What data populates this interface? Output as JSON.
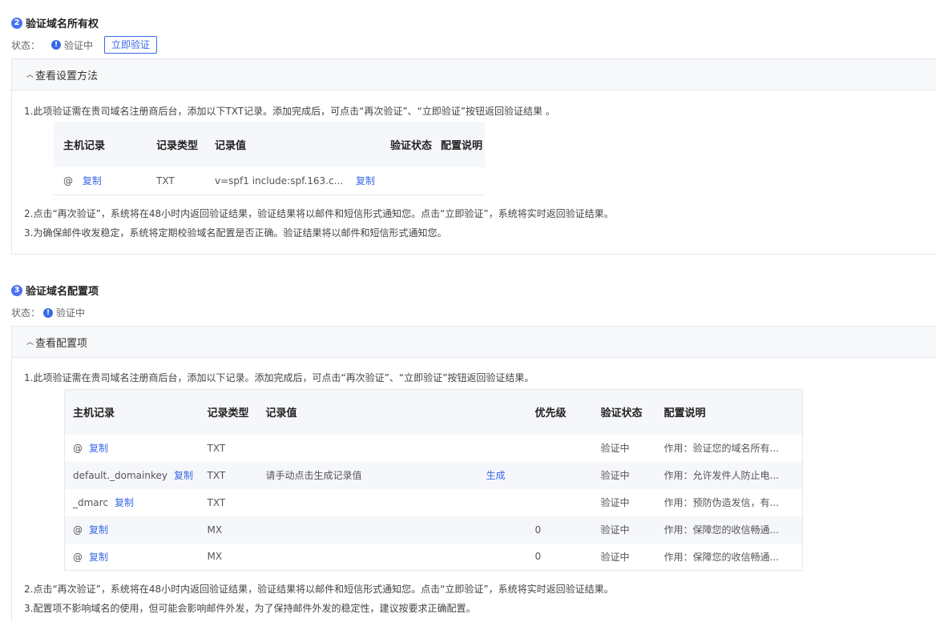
{
  "section2": {
    "step": "2",
    "title": "验证域名所有权",
    "status_label": "状态：",
    "status_value": "验证中",
    "verify_button": "立即验证",
    "panel_title": "查看设置方法",
    "line1": "1.此项验证需在贵司域名注册商后台，添加以下TXT记录。添加完成后，可点击“再次验证”、“立即验证”按钮返回验证结果 。",
    "table": {
      "headers": [
        "主机记录",
        "记录类型",
        "记录值",
        "验证状态",
        "配置说明"
      ],
      "row": {
        "host": "@",
        "copy": "复制",
        "type": "TXT",
        "value": "v=spf1 include:spf.163.c...",
        "value_copy": "复制"
      }
    },
    "line2": "2.点击“再次验证”，系统将在48小时内返回验证结果，验证结果将以邮件和短信形式通知您。点击“立即验证”，系统将实时返回验证结果。",
    "line3": "3.为确保邮件收发稳定，系统将定期校验域名配置是否正确。验证结果将以邮件和短信形式通知您。"
  },
  "section3": {
    "step": "3",
    "title": "验证域名配置项",
    "status_label": "状态：",
    "status_value": "验证中",
    "panel_title": "查看配置项",
    "line1": "1.此项验证需在贵司域名注册商后台，添加以下记录。添加完成后，可点击“再次验证”、“立即验证”按钮返回验证结果。",
    "table": {
      "headers": [
        "主机记录",
        "记录类型",
        "记录值",
        "优先级",
        "验证状态",
        "配置说明"
      ],
      "rows": [
        {
          "host": "@",
          "copy": "复制",
          "type": "TXT",
          "value": "",
          "action": "",
          "priority": "",
          "status": "验证中",
          "desc": "作用：验证您的域名所有..."
        },
        {
          "host": "default._domainkey",
          "copy": "复制",
          "type": "TXT",
          "value": "请手动点击生成记录值",
          "action": "生成",
          "priority": "",
          "status": "验证中",
          "desc": "作用：允许发件人防止电..."
        },
        {
          "host": "_dmarc",
          "copy": "复制",
          "type": "TXT",
          "value": "",
          "action": "",
          "priority": "",
          "status": "验证中",
          "desc": "作用：预防伪造发信，有..."
        },
        {
          "host": "@",
          "copy": "复制",
          "type": "MX",
          "value": "",
          "action": "",
          "priority": "0",
          "status": "验证中",
          "desc": "作用：保障您的收信畅通..."
        },
        {
          "host": "@",
          "copy": "复制",
          "type": "MX",
          "value": "",
          "action": "",
          "priority": "0",
          "status": "验证中",
          "desc": "作用：保障您的收信畅通..."
        }
      ]
    },
    "line2": "2.点击“再次验证”，系统将在48小时内返回验证结果，验证结果将以邮件和短信形式通知您。点击“立即验证”，系统将实时返回验证结果。",
    "line3": "3.配置项不影响域名的使用，但可能会影响邮件外发，为了保持邮件外发的稳定性，建议按要求正确配置。"
  }
}
